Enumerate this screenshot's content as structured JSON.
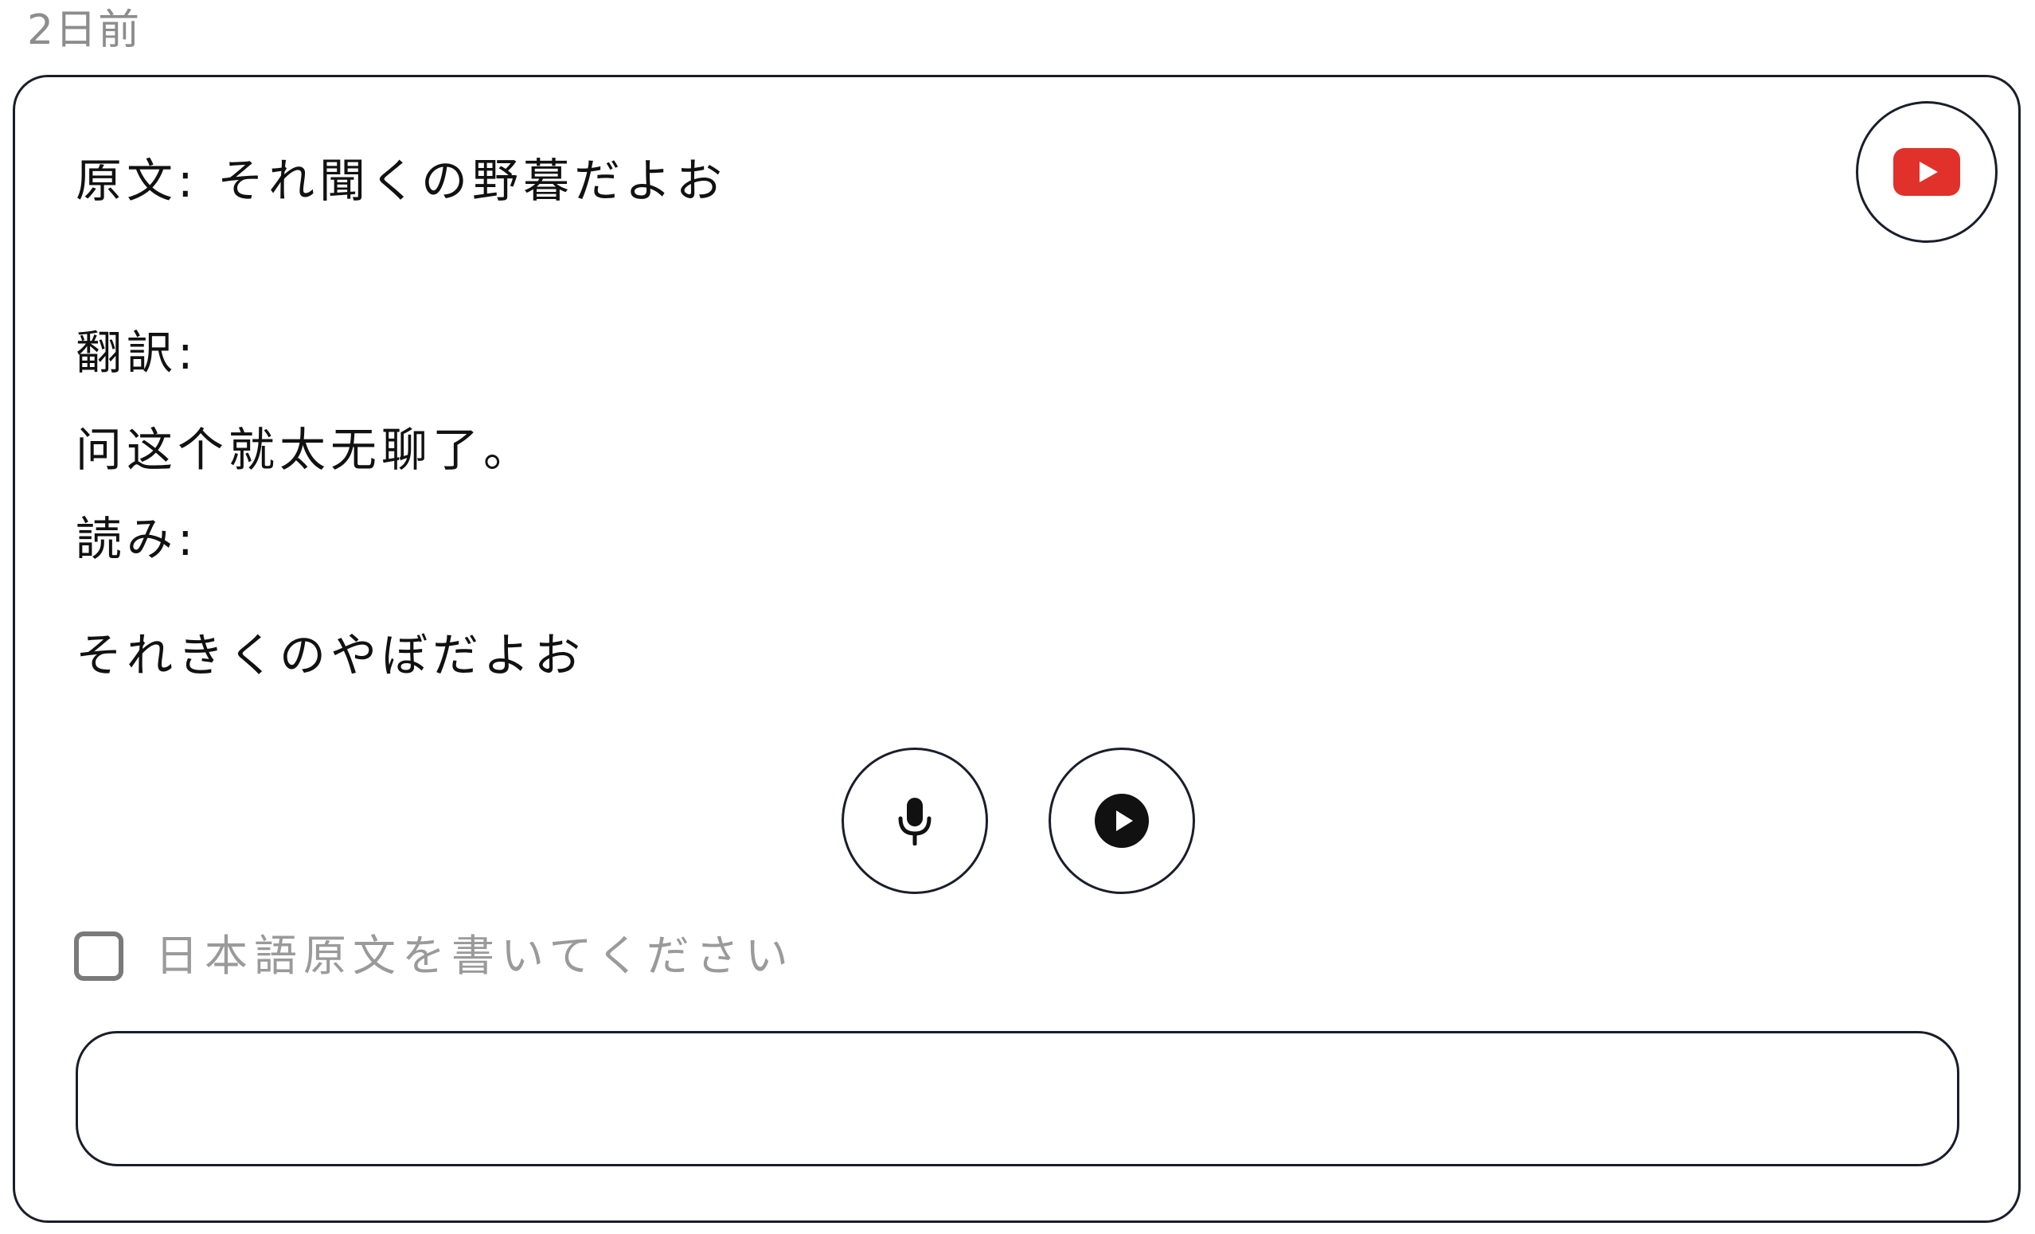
{
  "header": {
    "timestamp": "2日前"
  },
  "card": {
    "original_label": "原文:",
    "original_text": "それ聞くの野暮だよお",
    "translation_label": "翻訳:",
    "translation_text": "问这个就太无聊了。",
    "reading_label": "読み:",
    "reading_text": "それきくのやぼだよお",
    "icons": {
      "youtube": "youtube-icon",
      "mic": "microphone-icon",
      "play": "play-circle-icon"
    },
    "colors": {
      "youtube_red": "#e0322a",
      "border": "#1a1d2b",
      "muted_text": "#9a9a9a"
    },
    "checkbox": {
      "label": "日本語原文を書いてください",
      "checked": false
    },
    "answer_input": {
      "value": "",
      "placeholder": ""
    }
  }
}
